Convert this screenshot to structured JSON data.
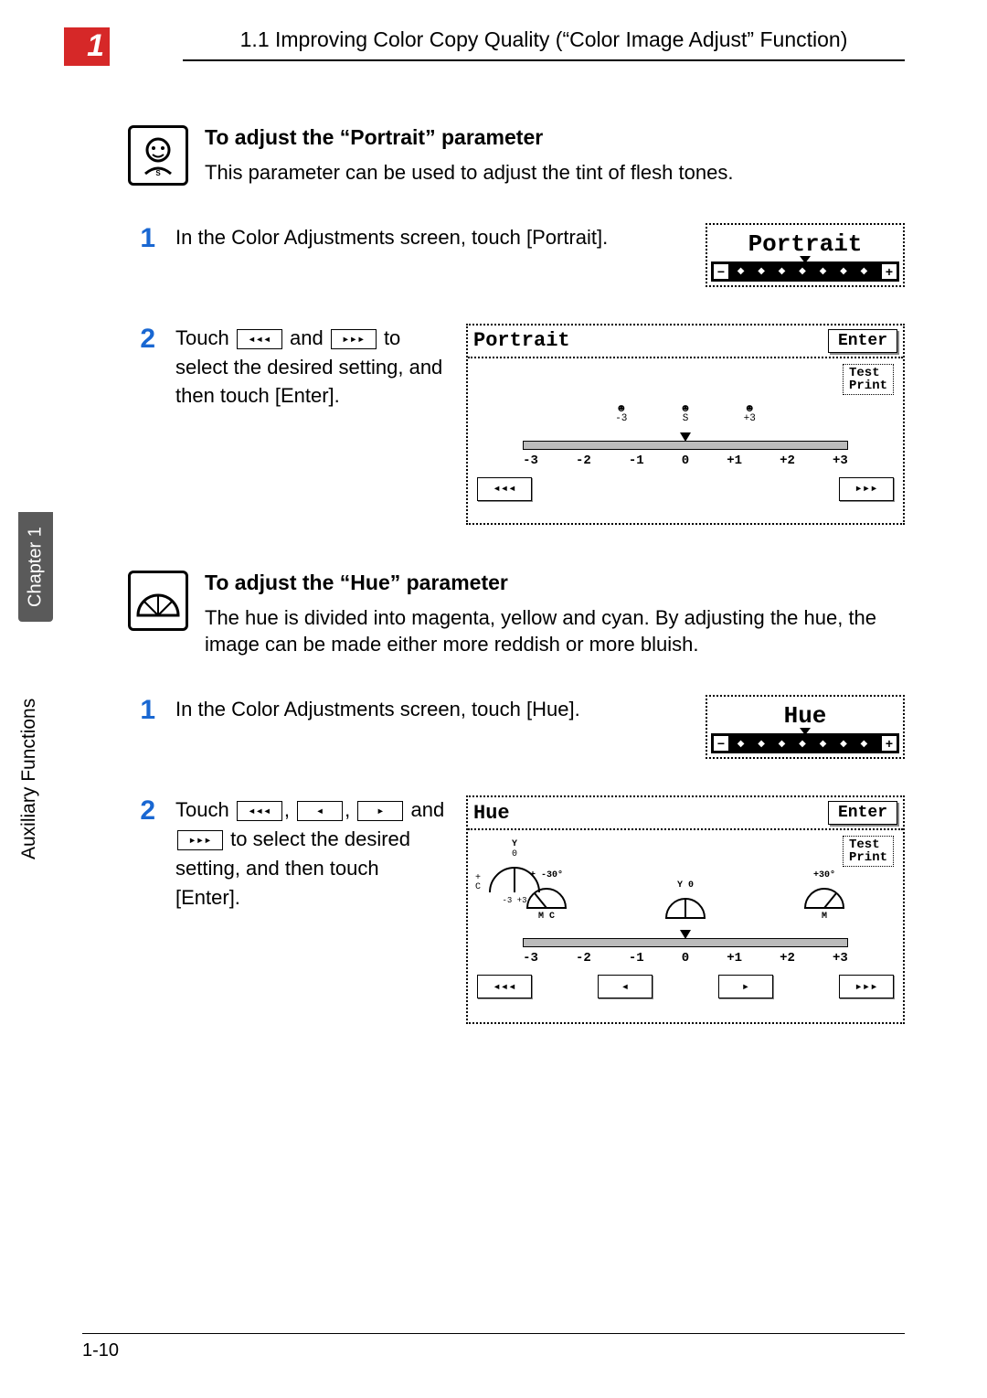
{
  "header": {
    "chapter_number": "1",
    "running_head": "1.1 Improving Color Copy Quality (“Color Image Adjust” Function)"
  },
  "sidebar": {
    "chapter_label": "Chapter 1",
    "section_label": "Auxiliary Functions"
  },
  "portrait": {
    "heading": "To adjust the “Portrait” parameter",
    "body": "This parameter can be used to adjust the tint of flesh tones.",
    "steps": [
      "In the Color Adjustments screen, touch [Portrait].",
      "to select the desired setting, and then touch [Enter]."
    ],
    "step2_prefix": "Touch",
    "step2_mid": "and",
    "mini_title": "Portrait",
    "panel": {
      "title": "Portrait",
      "enter": "Enter",
      "test_print": "Test\nPrint",
      "scale_labels": [
        "-3",
        "-2",
        "-1",
        "0",
        "+1",
        "+2",
        "+3"
      ],
      "face_labels": [
        "-3",
        "S",
        "+3"
      ],
      "btn_left": "◂◂◂",
      "btn_right": "▸▸▸"
    }
  },
  "hue": {
    "heading": "To adjust the “Hue” parameter",
    "body": "The hue is divided into magenta, yellow and cyan. By adjusting the hue, the image can be made either more reddish or more bluish.",
    "steps": [
      "In the Color Adjustments screen, touch [Hue].",
      "to select the desired setting, and then touch [Enter]."
    ],
    "step2_prefix": "Touch",
    "step2_mid1": ",",
    "step2_mid2": ",",
    "step2_mid3": "and",
    "mini_title": "Hue",
    "panel": {
      "title": "Hue",
      "enter": "Enter",
      "test_print": "Test\nPrint",
      "scale_labels": [
        "-3",
        "-2",
        "-1",
        "0",
        "+1",
        "+2",
        "+3"
      ],
      "fan_labels_top": [
        "Y",
        "Y",
        "Y"
      ],
      "fan_left_text": "-30°",
      "fan_mid_text": "0",
      "fan_right_text": "+30°",
      "dial_label": "0",
      "dial_range": "-3  +3",
      "legend": "+\nC",
      "btn_ll": "◂◂◂",
      "btn_l": "◂",
      "btn_r": "▸",
      "btn_rr": "▸▸▸"
    }
  },
  "icons": {
    "arrow3_left": "◂◂◂",
    "arrow3_right": "▸▸▸",
    "arrow1_left": "◂",
    "arrow1_right": "▸"
  },
  "footer": {
    "page": "1-10"
  }
}
